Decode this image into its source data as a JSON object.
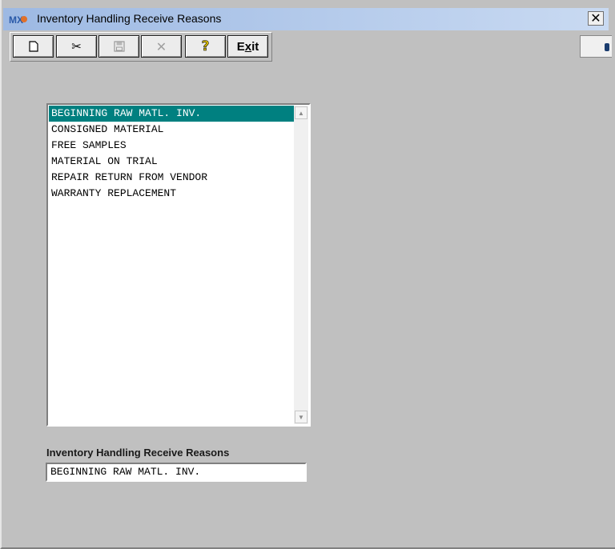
{
  "window": {
    "title": "Inventory Handling Receive Reasons",
    "app_icon_label": "MX",
    "close_label": "✕"
  },
  "toolbar": {
    "buttons": [
      {
        "name": "new",
        "icon": "new-document-icon",
        "enabled": true
      },
      {
        "name": "cut",
        "icon": "scissors-icon",
        "glyph": "✂",
        "enabled": true
      },
      {
        "name": "save",
        "icon": "floppy-disk-icon",
        "enabled": false
      },
      {
        "name": "delete",
        "icon": "x-icon",
        "glyph": "✕",
        "enabled": false
      },
      {
        "name": "help",
        "icon": "question-mark-icon",
        "glyph": "?",
        "enabled": true
      },
      {
        "name": "exit",
        "label_pre": "E",
        "label_underline": "x",
        "label_post": "it",
        "enabled": true
      }
    ]
  },
  "reasons_list": {
    "selected_index": 0,
    "items": [
      "BEGINNING RAW MATL. INV.",
      "CONSIGNED MATERIAL",
      "FREE SAMPLES",
      "MATERIAL ON TRIAL",
      "REPAIR RETURN FROM VENDOR",
      "WARRANTY REPLACEMENT"
    ]
  },
  "detail": {
    "label": "Inventory Handling Receive Reasons",
    "value": "BEGINNING RAW MATL. INV."
  },
  "colors": {
    "selection": "#008080",
    "titlebar_start": "#9db9e3",
    "titlebar_end": "#c9daf2",
    "background": "#c0c0c0"
  }
}
